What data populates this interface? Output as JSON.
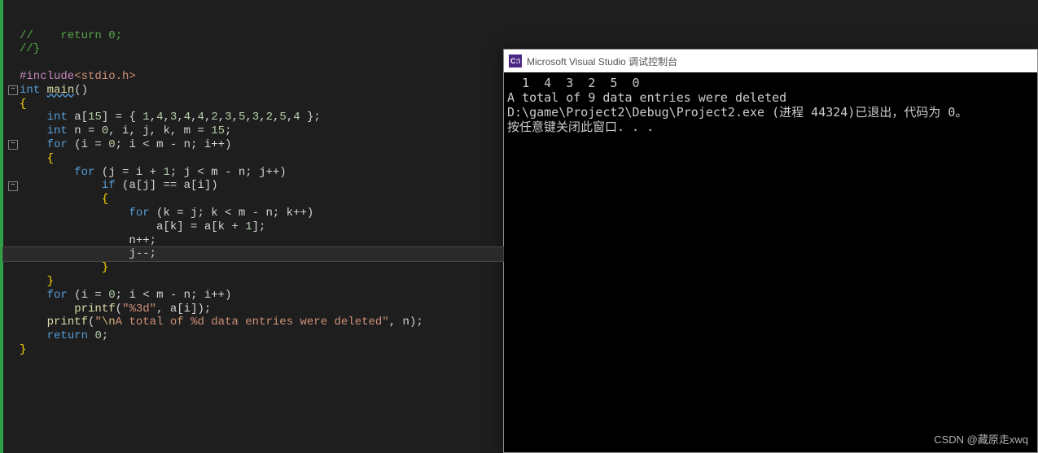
{
  "editor": {
    "lines": [
      {
        "indent": 0,
        "tokens": [
          {
            "t": "//",
            "c": "cmt"
          },
          {
            "t": "    ",
            "c": "txt"
          },
          {
            "t": "return 0;",
            "c": "cmt"
          }
        ]
      },
      {
        "indent": 0,
        "tokens": [
          {
            "t": "//}",
            "c": "cmt"
          }
        ]
      },
      {
        "indent": 0,
        "tokens": []
      },
      {
        "indent": 0,
        "tokens": [
          {
            "t": "#include",
            "c": "inc"
          },
          {
            "t": "<stdio.h>",
            "c": "str"
          }
        ]
      },
      {
        "indent": 0,
        "fold": "minus",
        "tokens": [
          {
            "t": "int",
            "c": "kw"
          },
          {
            "t": " ",
            "c": "txt"
          },
          {
            "t": "main",
            "c": "fn fn-underline"
          },
          {
            "t": "()",
            "c": "txt"
          }
        ]
      },
      {
        "indent": 0,
        "tokens": [
          {
            "t": "{",
            "c": "br"
          }
        ]
      },
      {
        "indent": 1,
        "tokens": [
          {
            "t": "int",
            "c": "kw"
          },
          {
            "t": " a[",
            "c": "txt"
          },
          {
            "t": "15",
            "c": "num"
          },
          {
            "t": "] = { ",
            "c": "txt"
          },
          {
            "t": "1",
            "c": "num"
          },
          {
            "t": ",",
            "c": "txt"
          },
          {
            "t": "4",
            "c": "num"
          },
          {
            "t": ",",
            "c": "txt"
          },
          {
            "t": "3",
            "c": "num"
          },
          {
            "t": ",",
            "c": "txt"
          },
          {
            "t": "4",
            "c": "num"
          },
          {
            "t": ",",
            "c": "txt"
          },
          {
            "t": "4",
            "c": "num"
          },
          {
            "t": ",",
            "c": "txt"
          },
          {
            "t": "2",
            "c": "num"
          },
          {
            "t": ",",
            "c": "txt"
          },
          {
            "t": "3",
            "c": "num"
          },
          {
            "t": ",",
            "c": "txt"
          },
          {
            "t": "5",
            "c": "num"
          },
          {
            "t": ",",
            "c": "txt"
          },
          {
            "t": "3",
            "c": "num"
          },
          {
            "t": ",",
            "c": "txt"
          },
          {
            "t": "2",
            "c": "num"
          },
          {
            "t": ",",
            "c": "txt"
          },
          {
            "t": "5",
            "c": "num"
          },
          {
            "t": ",",
            "c": "txt"
          },
          {
            "t": "4",
            "c": "num"
          },
          {
            "t": " };",
            "c": "txt"
          }
        ]
      },
      {
        "indent": 1,
        "tokens": [
          {
            "t": "int",
            "c": "kw"
          },
          {
            "t": " n = ",
            "c": "txt"
          },
          {
            "t": "0",
            "c": "num"
          },
          {
            "t": ", i, j, k, m = ",
            "c": "txt"
          },
          {
            "t": "15",
            "c": "num"
          },
          {
            "t": ";",
            "c": "txt"
          }
        ]
      },
      {
        "indent": 1,
        "fold": "minus",
        "tokens": [
          {
            "t": "for",
            "c": "kw"
          },
          {
            "t": " (i = ",
            "c": "txt"
          },
          {
            "t": "0",
            "c": "num"
          },
          {
            "t": "; i < m - n; i++)",
            "c": "txt"
          }
        ]
      },
      {
        "indent": 1,
        "tokens": [
          {
            "t": "{",
            "c": "br"
          }
        ]
      },
      {
        "indent": 2,
        "tokens": [
          {
            "t": "for",
            "c": "kw"
          },
          {
            "t": " (j = i + ",
            "c": "txt"
          },
          {
            "t": "1",
            "c": "num"
          },
          {
            "t": "; j < m - n; j++)",
            "c": "txt"
          }
        ]
      },
      {
        "indent": 3,
        "fold": "minus",
        "tokens": [
          {
            "t": "if",
            "c": "kw"
          },
          {
            "t": " (a[j] == a[i])",
            "c": "txt"
          }
        ]
      },
      {
        "indent": 3,
        "tokens": [
          {
            "t": "{",
            "c": "br"
          }
        ]
      },
      {
        "indent": 4,
        "tokens": [
          {
            "t": "for",
            "c": "kw"
          },
          {
            "t": " (k = j; k < m - n; k++)",
            "c": "txt"
          }
        ]
      },
      {
        "indent": 5,
        "tokens": [
          {
            "t": "a[k] = a[k + ",
            "c": "txt"
          },
          {
            "t": "1",
            "c": "num"
          },
          {
            "t": "];",
            "c": "txt"
          }
        ]
      },
      {
        "indent": 4,
        "tokens": [
          {
            "t": "n++;",
            "c": "txt"
          }
        ]
      },
      {
        "indent": 4,
        "hl": true,
        "tokens": [
          {
            "t": "j--;",
            "c": "txt"
          }
        ]
      },
      {
        "indent": 3,
        "tokens": [
          {
            "t": "}",
            "c": "br"
          }
        ]
      },
      {
        "indent": 1,
        "tokens": [
          {
            "t": "}",
            "c": "br"
          }
        ]
      },
      {
        "indent": 1,
        "tokens": [
          {
            "t": "for",
            "c": "kw"
          },
          {
            "t": " (i = ",
            "c": "txt"
          },
          {
            "t": "0",
            "c": "num"
          },
          {
            "t": "; i < m - n; i++)",
            "c": "txt"
          }
        ]
      },
      {
        "indent": 2,
        "tokens": [
          {
            "t": "printf",
            "c": "fn"
          },
          {
            "t": "(",
            "c": "txt"
          },
          {
            "t": "\"%3d\"",
            "c": "str"
          },
          {
            "t": ", a[i]);",
            "c": "txt"
          }
        ]
      },
      {
        "indent": 1,
        "tokens": [
          {
            "t": "printf",
            "c": "fn"
          },
          {
            "t": "(",
            "c": "txt"
          },
          {
            "t": "\"",
            "c": "str"
          },
          {
            "t": "\\n",
            "c": "esc"
          },
          {
            "t": "A total of %d data entries were deleted\"",
            "c": "str"
          },
          {
            "t": ", n);",
            "c": "txt"
          }
        ]
      },
      {
        "indent": 1,
        "tokens": [
          {
            "t": "return",
            "c": "kw"
          },
          {
            "t": " ",
            "c": "txt"
          },
          {
            "t": "0",
            "c": "num"
          },
          {
            "t": ";",
            "c": "txt"
          }
        ]
      },
      {
        "indent": 0,
        "tokens": [
          {
            "t": "}",
            "c": "br"
          }
        ]
      }
    ]
  },
  "console": {
    "icon_text": "C:\\",
    "title": "Microsoft Visual Studio 调试控制台",
    "output": "  1  4  3  2  5  0\nA total of 9 data entries were deleted\nD:\\game\\Project2\\Debug\\Project2.exe (进程 44324)已退出，代码为 0。\n按任意键关闭此窗口. . ."
  },
  "watermark": "CSDN @藏原走xwq"
}
